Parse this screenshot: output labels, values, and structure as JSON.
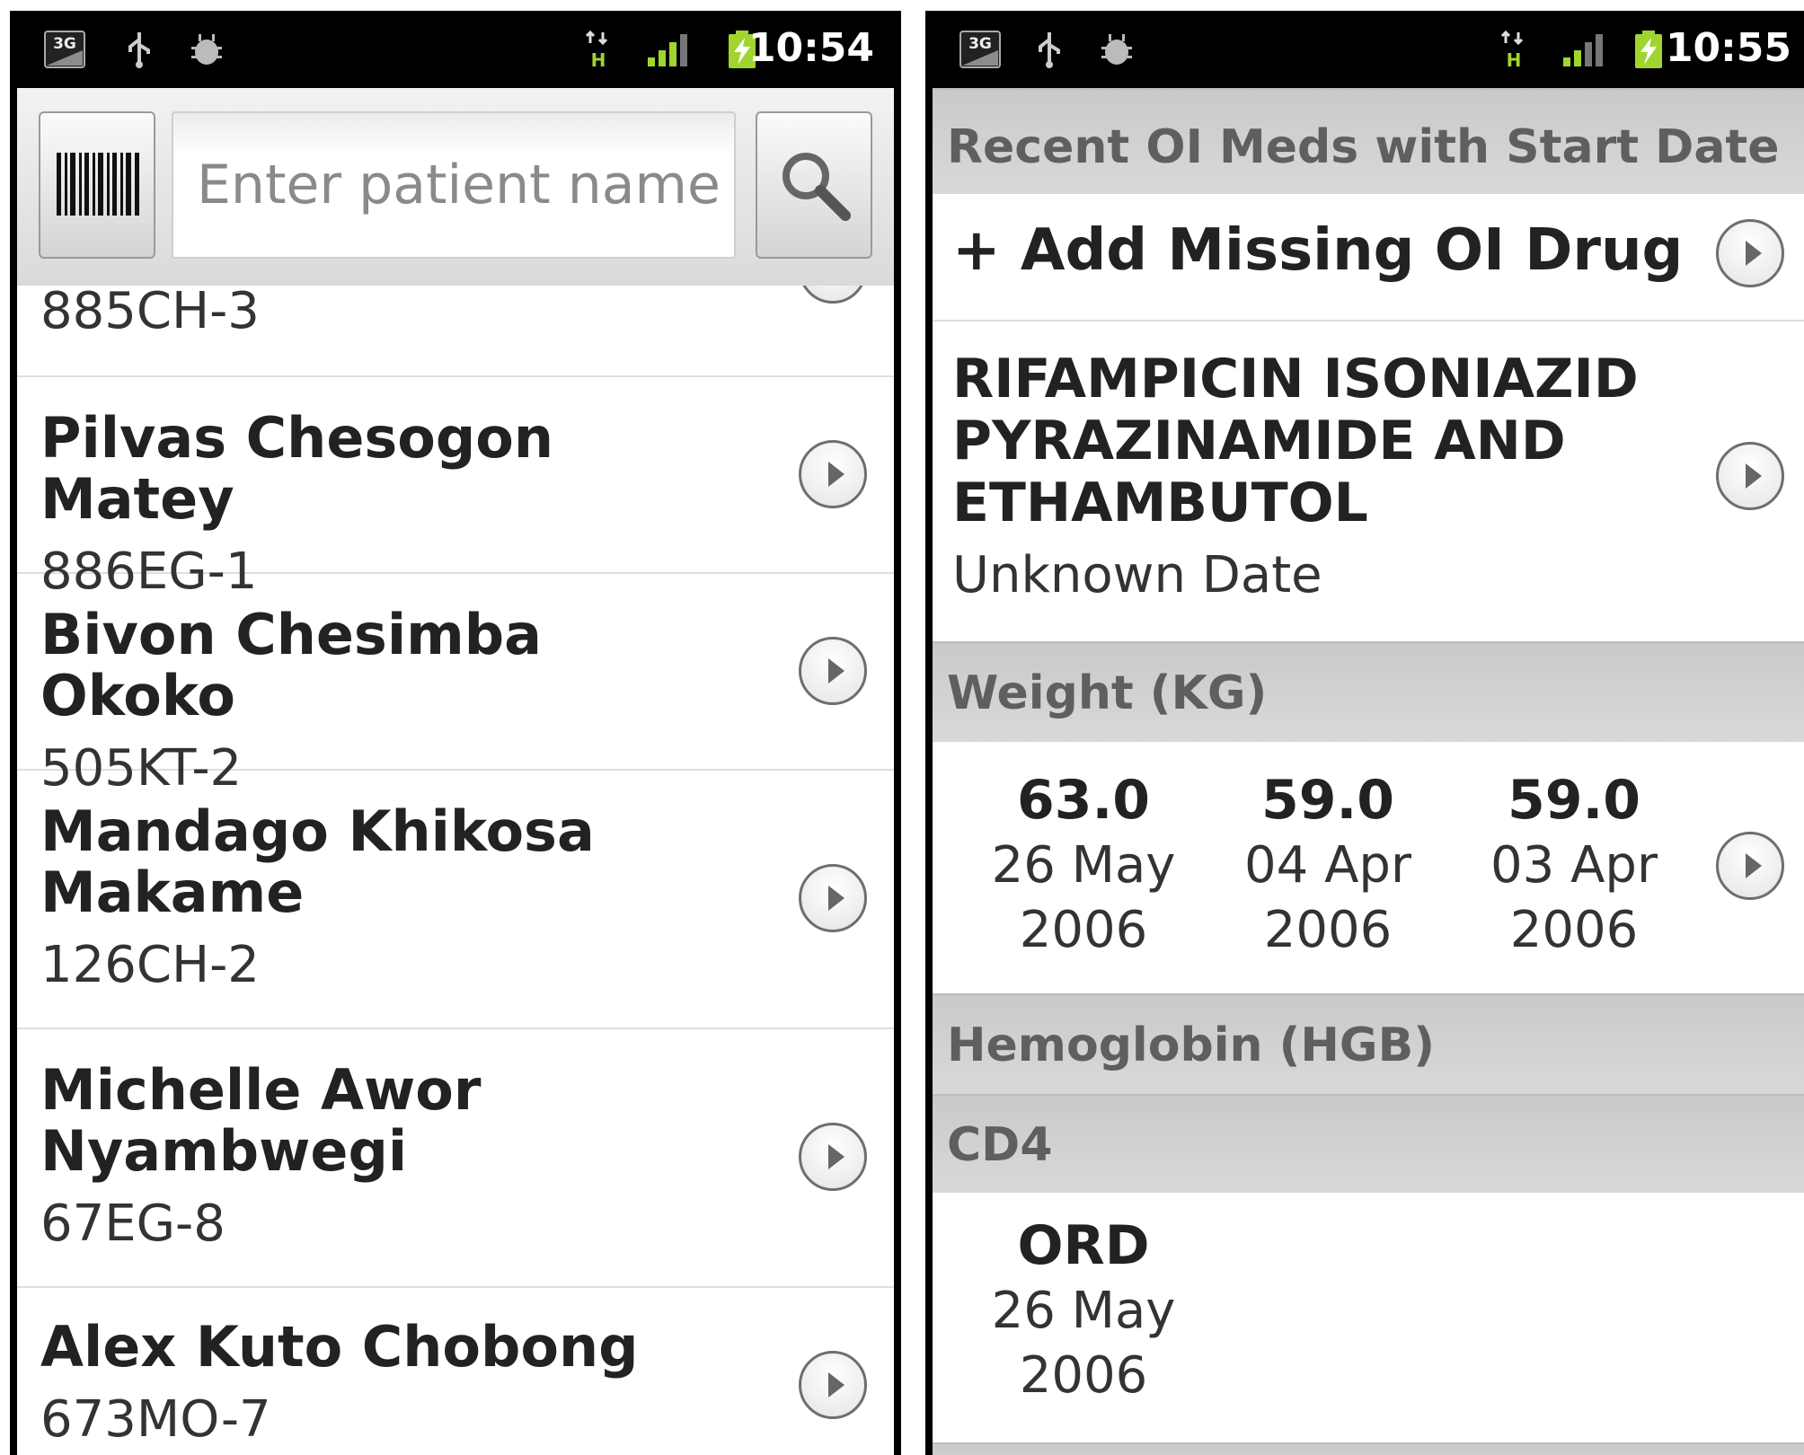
{
  "left": {
    "status": {
      "time": "10:54",
      "network": "3G"
    },
    "search": {
      "placeholder": "Enter patient name"
    },
    "patients": [
      {
        "name": "",
        "id": "885CH-3"
      },
      {
        "name": "Pilvas Chesogon Matey",
        "id": "886EG-1"
      },
      {
        "name": "Bivon Chesimba Okoko",
        "id": "505KT-2"
      },
      {
        "name": "Mandago Khikosa Makame",
        "id": "126CH-2"
      },
      {
        "name": "Michelle Awor Nyambwegi",
        "id": "67EG-8"
      },
      {
        "name": "Alex Kuto Chobong",
        "id": "673MO-7"
      }
    ]
  },
  "right": {
    "status": {
      "time": "10:55",
      "network": "3G"
    },
    "oi_header": "Recent OI Meds with Start Date",
    "add_missing": "+ Add Missing OI Drug",
    "drug": {
      "name": "RIFAMPICIN ISONIAZID PYRAZINAMIDE AND ETHAMBUTOL",
      "date": "Unknown Date"
    },
    "weight_header": "Weight (KG)",
    "weights": [
      {
        "value": "63.0",
        "date": "26 May 2006"
      },
      {
        "value": "59.0",
        "date": "04 Apr 2006"
      },
      {
        "value": "59.0",
        "date": "03 Apr 2006"
      }
    ],
    "hgb_header": "Hemoglobin (HGB)",
    "cd4_header": "CD4",
    "cd4": [
      {
        "value": "ORD",
        "date": "26 May 2006"
      }
    ]
  }
}
